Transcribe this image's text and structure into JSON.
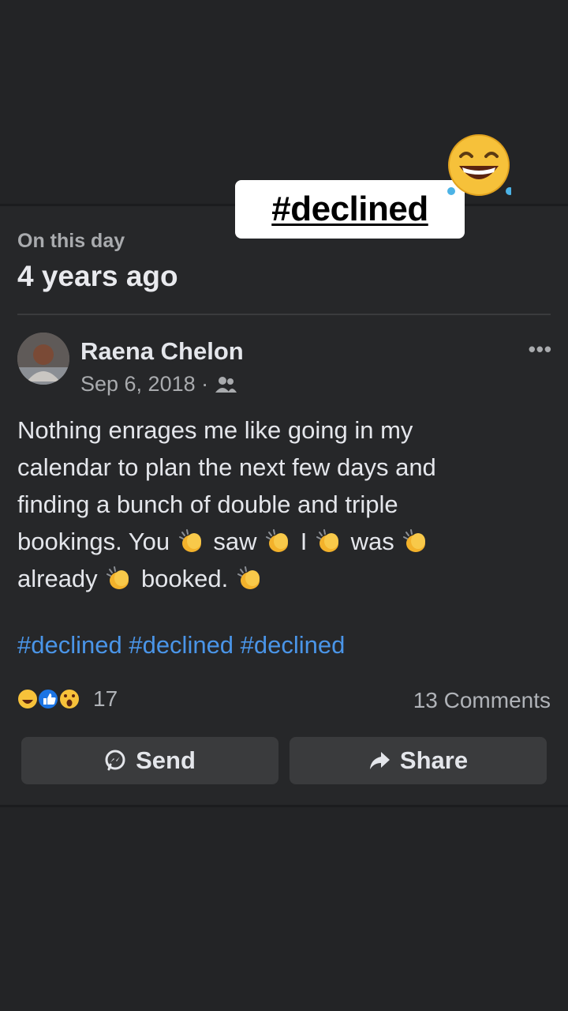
{
  "sticker": {
    "text": "#declined",
    "emoji": "laughing-tears-emoji"
  },
  "memory": {
    "kicker": "On this day",
    "title": "4 years ago"
  },
  "post": {
    "author": "Raena Chelon",
    "date": "Sep 6, 2018 ·",
    "audience_icon": "friends-icon",
    "more_label": "•••",
    "text_parts": {
      "line1": "Nothing enrages me like going in my",
      "line2": "calendar to plan the next few days and",
      "line3": "finding a bunch of double and triple",
      "w1": "bookings.  You",
      "w2": "saw",
      "w3": "I",
      "w4": "was",
      "w5": "already",
      "w6": "booked."
    },
    "hashtags": "#declined #declined #declined",
    "reaction_count": "17",
    "comments": "13 Comments"
  },
  "actions": {
    "send": "Send",
    "share": "Share"
  },
  "colors": {
    "background": "#232426",
    "card": "#262729",
    "hashtag": "#4a95e8",
    "button": "#3a3b3d"
  }
}
